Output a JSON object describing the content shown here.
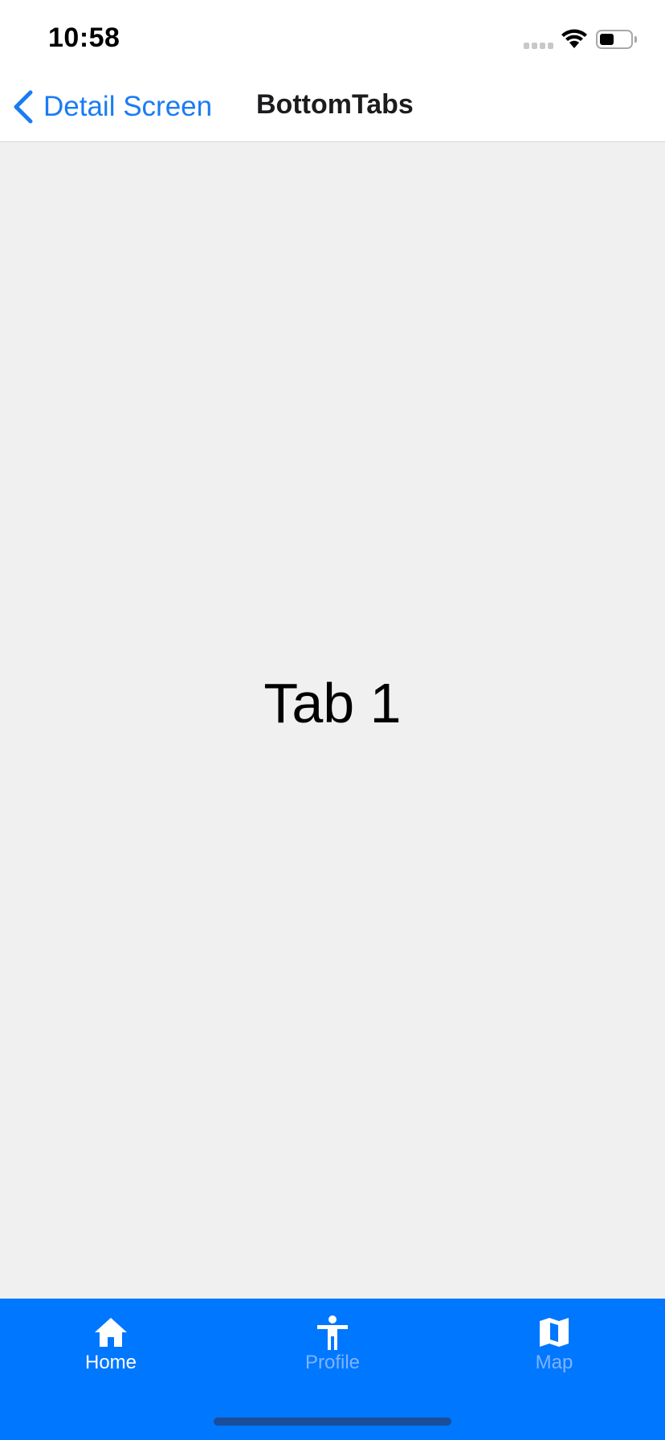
{
  "status_bar": {
    "time": "10:58",
    "icons": [
      "signal-icon",
      "wifi-icon",
      "battery-icon"
    ]
  },
  "nav": {
    "back_label": "Detail Screen",
    "title": "BottomTabs",
    "back_icon": "chevron-left-icon"
  },
  "content": {
    "label": "Tab 1"
  },
  "tabs": [
    {
      "label": "Home",
      "icon": "home-icon",
      "active": true
    },
    {
      "label": "Profile",
      "icon": "accessibility-icon",
      "active": false
    },
    {
      "label": "Map",
      "icon": "map-icon",
      "active": false
    }
  ],
  "colors": {
    "accent": "#1a7cf2",
    "tab_bar": "#0077ff",
    "tab_active": "#ffffff",
    "tab_inactive": "#7fb3ff",
    "content_bg": "#f0f0f0"
  }
}
